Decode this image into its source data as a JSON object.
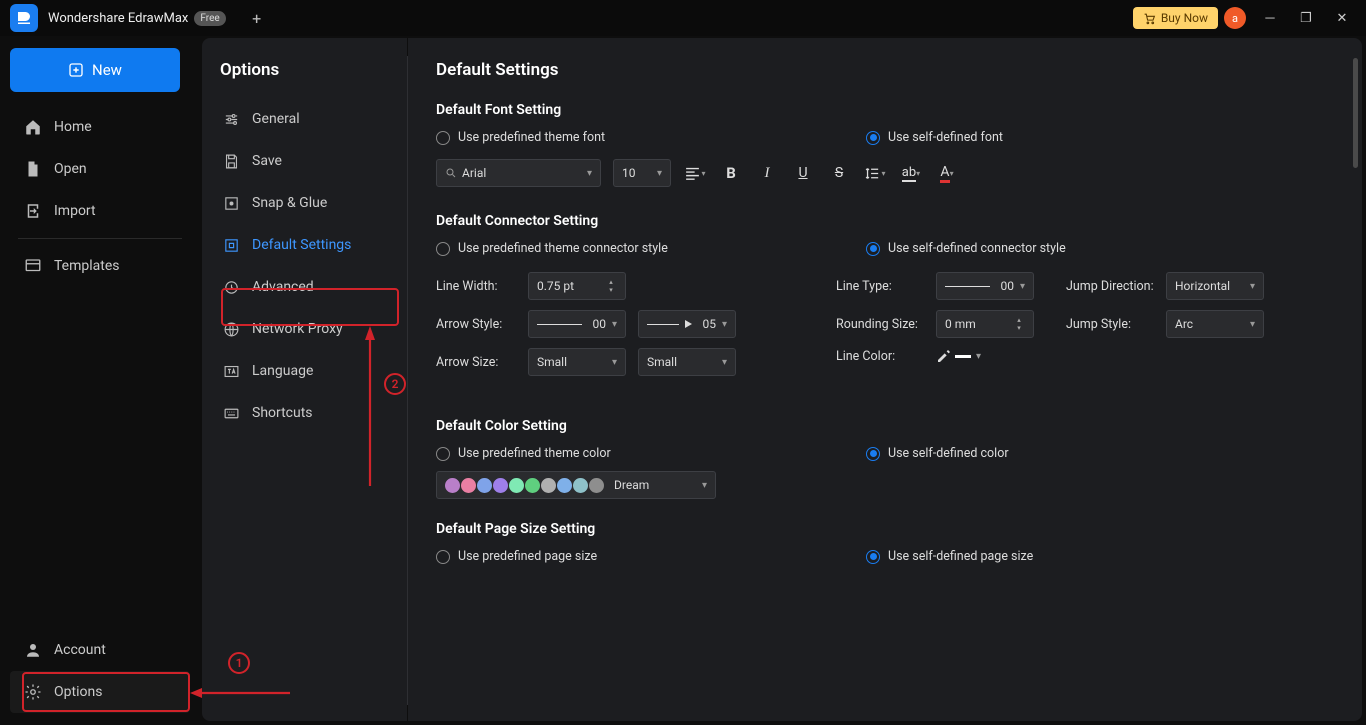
{
  "titlebar": {
    "app_name": "Wondershare EdrawMax",
    "free_badge": "Free",
    "buy_label": "Buy Now",
    "avatar_letter": "a"
  },
  "rail": {
    "new_label": "New",
    "items": [
      "Home",
      "Open",
      "Import"
    ],
    "templates": "Templates",
    "account": "Account",
    "options": "Options"
  },
  "options_panel": {
    "title": "Options",
    "items": [
      "General",
      "Save",
      "Snap & Glue",
      "Default Settings",
      "Advanced",
      "Network Proxy",
      "Language",
      "Shortcuts"
    ],
    "selected_index": 3
  },
  "content": {
    "heading": "Default Settings",
    "font_section": {
      "title": "Default Font Setting",
      "radio_predefined": "Use predefined theme font",
      "radio_self": "Use self-defined font",
      "font_name": "Arial",
      "font_size": "10"
    },
    "connector_section": {
      "title": "Default Connector Setting",
      "radio_predefined": "Use predefined theme connector style",
      "radio_self": "Use self-defined connector style",
      "line_width_label": "Line Width:",
      "line_width_val": "0.75 pt",
      "arrow_style_label": "Arrow Style:",
      "arrow_begin": "00",
      "arrow_end": "05",
      "arrow_size_label": "Arrow Size:",
      "arrow_begin_size": "Small",
      "arrow_end_size": "Small",
      "line_type_label": "Line Type:",
      "line_type_val": "00",
      "rounding_label": "Rounding Size:",
      "rounding_val": "0 mm",
      "line_color_label": "Line Color:",
      "jump_dir_label": "Jump Direction:",
      "jump_dir_val": "Horizontal",
      "jump_style_label": "Jump Style:",
      "jump_style_val": "Arc"
    },
    "color_section": {
      "title": "Default Color Setting",
      "radio_predefined": "Use predefined theme color",
      "radio_self": "Use self-defined color",
      "palette_name": "Dream",
      "palette_colors": [
        "#b97fc9",
        "#e97fa3",
        "#7fa3e9",
        "#9e7fe9",
        "#7fe9b4",
        "#5fcf7f",
        "#b0b0b0",
        "#7fb0e9",
        "#8ec1c9",
        "#8e8e8e"
      ]
    },
    "page_section": {
      "title": "Default Page Size Setting",
      "radio_predefined": "Use predefined page size",
      "radio_self": "Use self-defined page size"
    }
  },
  "annotations": {
    "one": "1",
    "two": "2"
  }
}
